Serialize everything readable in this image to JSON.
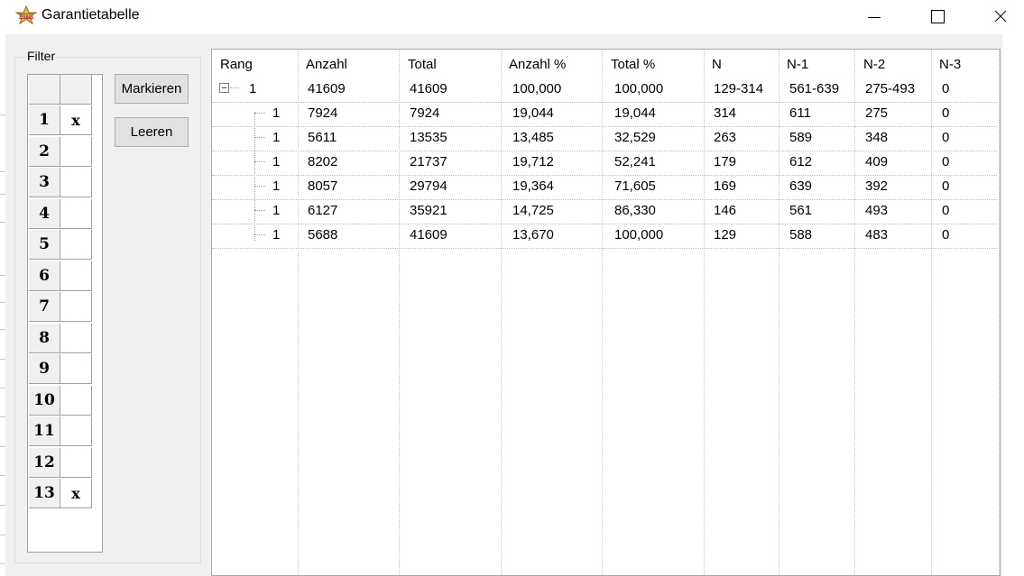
{
  "window": {
    "title": "Garantietabelle",
    "controls": {
      "minimize": "minimize-icon",
      "maximize": "maximize-icon",
      "close": "close-icon"
    }
  },
  "filter": {
    "label": "Filter",
    "rows": [
      {
        "num": "1",
        "mark": "x"
      },
      {
        "num": "2",
        "mark": ""
      },
      {
        "num": "3",
        "mark": ""
      },
      {
        "num": "4",
        "mark": ""
      },
      {
        "num": "5",
        "mark": ""
      },
      {
        "num": "6",
        "mark": ""
      },
      {
        "num": "7",
        "mark": ""
      },
      {
        "num": "8",
        "mark": ""
      },
      {
        "num": "9",
        "mark": ""
      },
      {
        "num": "10",
        "mark": ""
      },
      {
        "num": "11",
        "mark": ""
      },
      {
        "num": "12",
        "mark": ""
      },
      {
        "num": "13",
        "mark": "x"
      }
    ],
    "buttons": {
      "mark": "Markieren",
      "clear": "Leeren"
    }
  },
  "table": {
    "columns": [
      "Rang",
      "Anzahl",
      "Total",
      "Anzahl %",
      "Total %",
      "N",
      "N-1",
      "N-2",
      "N-3"
    ],
    "parent": [
      "1",
      "41609",
      "41609",
      "100,000",
      "100,000",
      "129-314",
      "561-639",
      "275-493",
      "0"
    ],
    "children": [
      [
        "1",
        "7924",
        "7924",
        "19,044",
        "19,044",
        "314",
        "611",
        "275",
        "0"
      ],
      [
        "1",
        "5611",
        "13535",
        "13,485",
        "32,529",
        "263",
        "589",
        "348",
        "0"
      ],
      [
        "1",
        "8202",
        "21737",
        "19,712",
        "52,241",
        "179",
        "612",
        "409",
        "0"
      ],
      [
        "1",
        "8057",
        "29794",
        "19,364",
        "71,605",
        "169",
        "639",
        "392",
        "0"
      ],
      [
        "1",
        "6127",
        "35921",
        "14,725",
        "86,330",
        "146",
        "561",
        "493",
        "0"
      ],
      [
        "1",
        "5688",
        "41609",
        "13,670",
        "100,000",
        "129",
        "588",
        "483",
        "0"
      ]
    ]
  }
}
